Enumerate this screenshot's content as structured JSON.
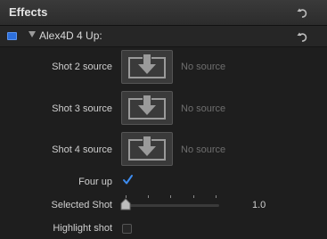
{
  "panel": {
    "title": "Effects"
  },
  "effect": {
    "name": "Alex4D 4 Up:",
    "enabled_color": "#2d6fdc"
  },
  "params": {
    "shots": [
      {
        "label": "Shot 2 source",
        "status": "No source"
      },
      {
        "label": "Shot 3 source",
        "status": "No source"
      },
      {
        "label": "Shot 4 source",
        "status": "No source"
      }
    ],
    "four_up": {
      "label": "Four up",
      "checked": true
    },
    "selected_shot": {
      "label": "Selected Shot",
      "value": "1.0"
    },
    "highlight_shot": {
      "label": "Highlight shot",
      "checked": false
    }
  }
}
